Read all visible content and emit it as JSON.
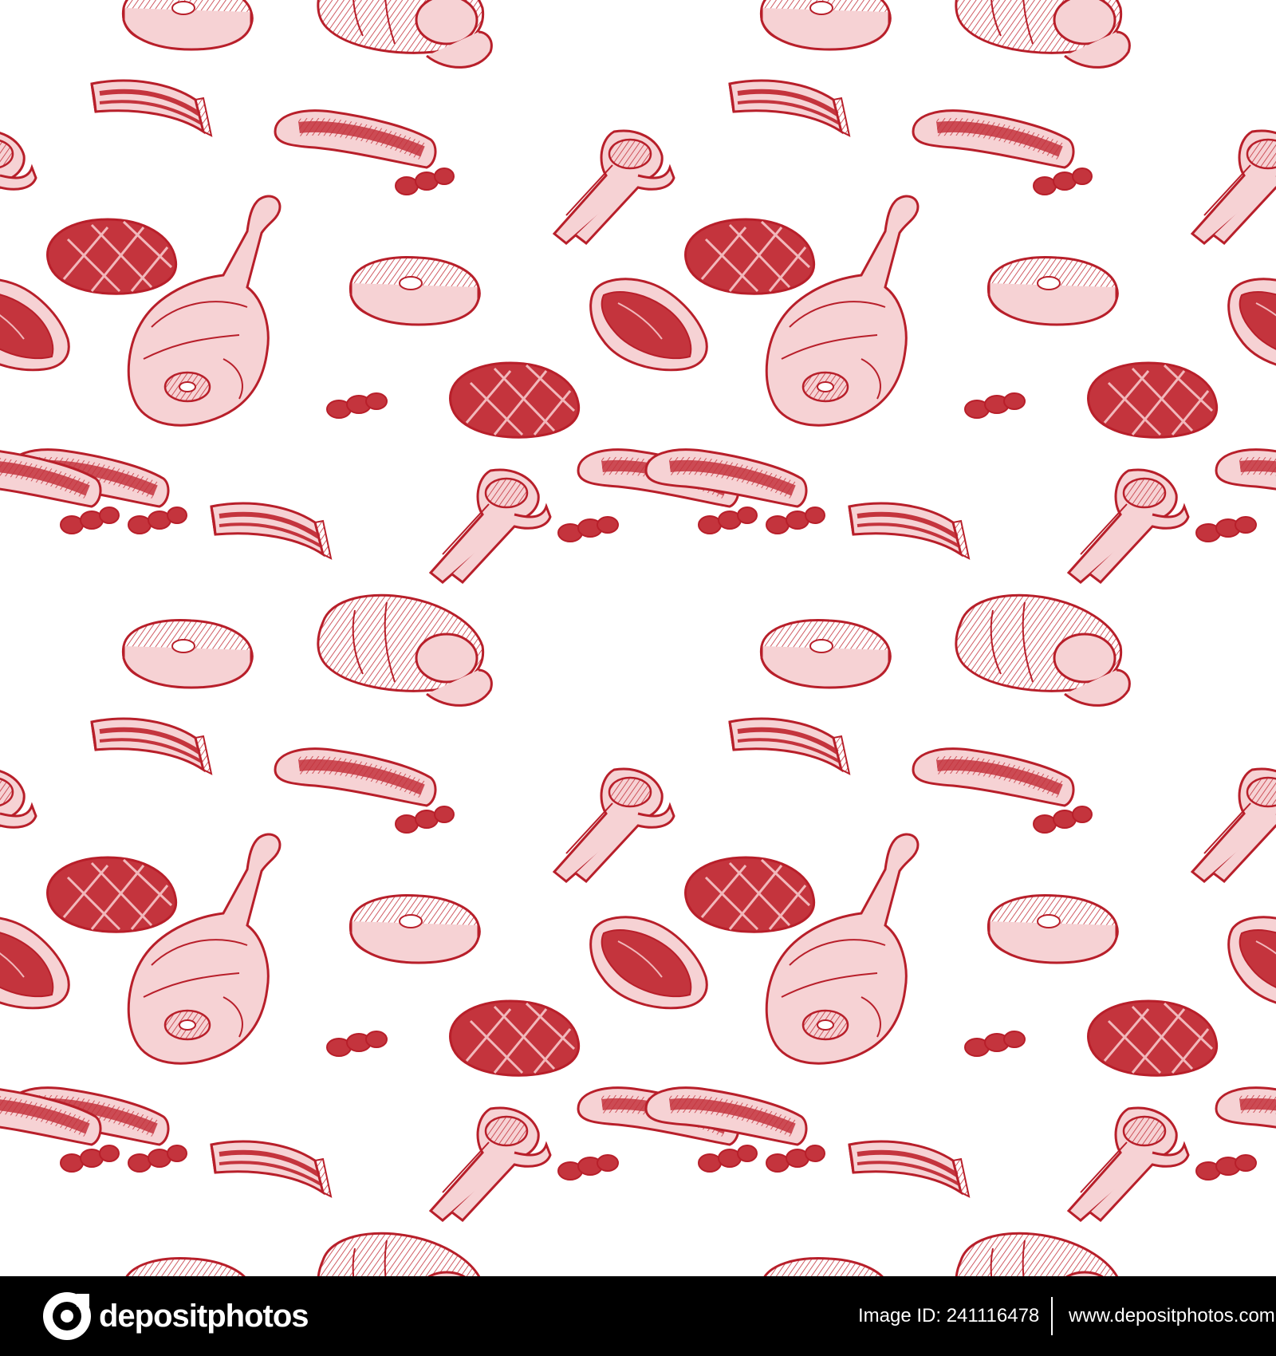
{
  "pattern": {
    "description_items": [
      "ham-leg-icon",
      "steak-icon",
      "bacon-icon",
      "sausage-icon",
      "lamb-rack-icon",
      "grilled-steak-icon",
      "meat-roll-icon",
      "salami-slices-icon"
    ],
    "ink_color": "#b81f2a",
    "fill_color": "#d9434d",
    "light_fill": "#f1b8bb",
    "background": "#ffffff"
  },
  "footer": {
    "logo_text": "depositphotos",
    "image_id": "Image ID: 241116478",
    "site_url": "www.depositphotos.com",
    "background": "#000000"
  }
}
